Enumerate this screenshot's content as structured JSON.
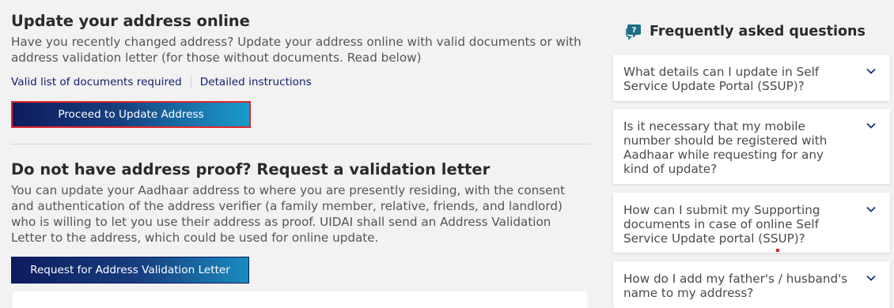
{
  "update_section": {
    "title": "Update your address online",
    "description": "Have you recently changed address? Update your address online with valid documents or with address validation letter (for those without documents. Read below)",
    "links": [
      "Valid list of documents required",
      "Detailed instructions"
    ],
    "button_label": "Proceed to Update Address"
  },
  "validation_section": {
    "title": "Do not have address proof? Request a validation letter",
    "description": "You can update your Aadhaar address to where you are presently residing, with the consent and authentication of the address verifier (a family member, relative, friends, and landlord) who is willing to let you use their address as proof. UIDAI shall send an Address Validation Letter to the address, which could be used for online update.",
    "button_label": "Request for Address Validation Letter"
  },
  "faq": {
    "title": "Frequently asked questions",
    "icon": "faq-chat-icon",
    "items": [
      {
        "question": "What details can I update in Self Service Update Portal (SSUP)?"
      },
      {
        "question": "Is it necessary that my mobile number should be registered with Aadhaar while requesting for any kind of update?"
      },
      {
        "question": "How can I submit my Supporting documents in case of online Self Service Update portal (SSUP)?"
      },
      {
        "question": "How do I add my father's / husband's name to my address?"
      }
    ]
  },
  "colors": {
    "accent_dark": "#0d1b5e",
    "accent_light": "#1a9ccc",
    "focus_border": "#e0262b",
    "link": "#14206b"
  }
}
